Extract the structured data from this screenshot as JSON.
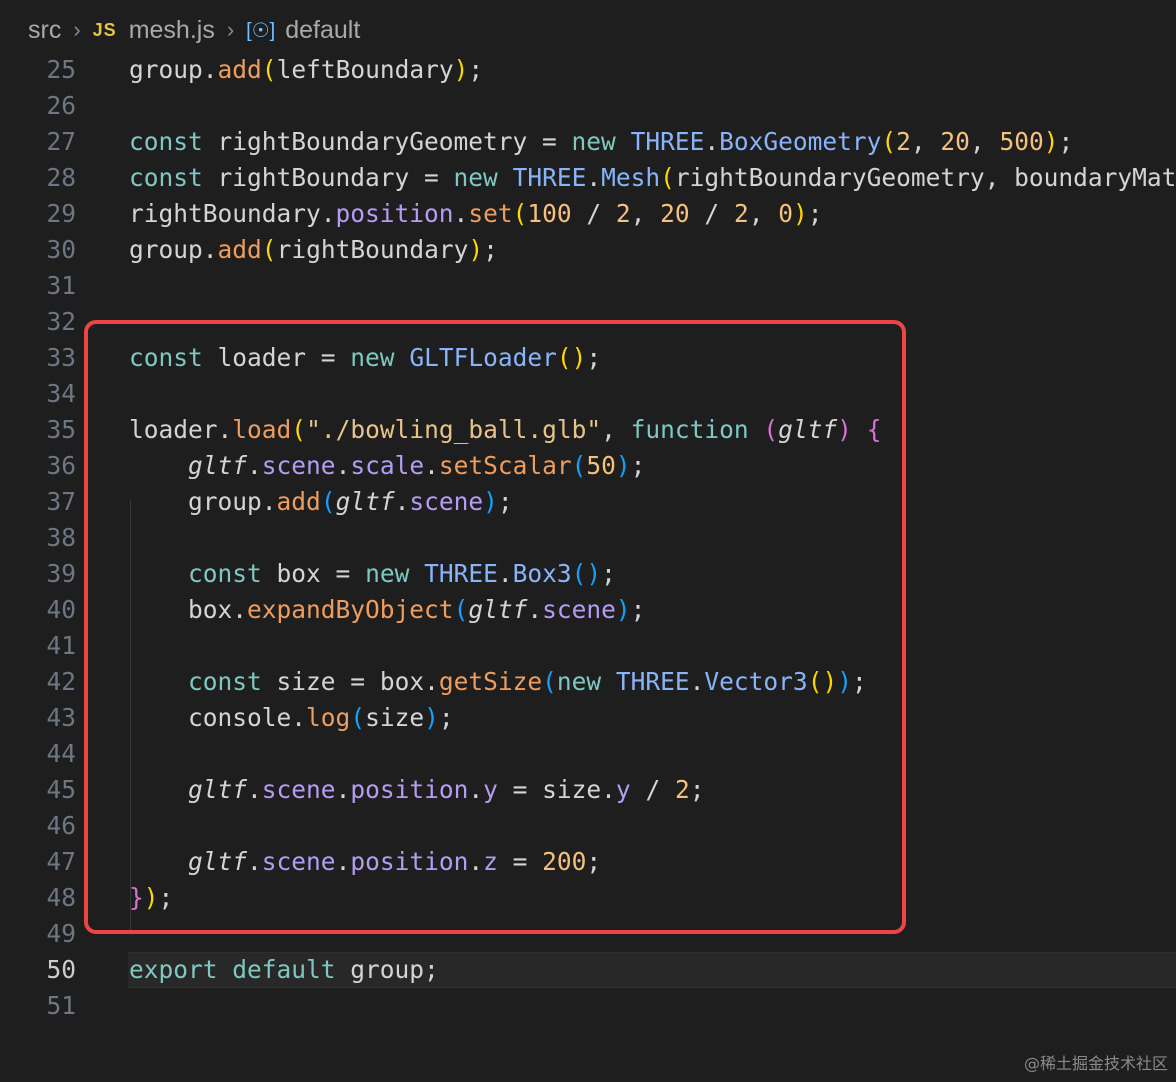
{
  "breadcrumb": {
    "folder": "src",
    "file_icon": "JS",
    "file": "mesh.js",
    "symbol_icon": "variable-icon",
    "symbol": "default"
  },
  "editor": {
    "current_line": 50,
    "highlight_range": [
      32,
      49
    ],
    "lines": [
      {
        "n": "25",
        "tokens": [
          [
            "id",
            "group"
          ],
          [
            "op",
            "."
          ],
          [
            "mth",
            "add"
          ],
          [
            "b1",
            "("
          ],
          [
            "id",
            "leftBoundary"
          ],
          [
            "b1",
            ")"
          ],
          [
            "op",
            ";"
          ]
        ]
      },
      {
        "n": "26",
        "tokens": []
      },
      {
        "n": "27",
        "tokens": [
          [
            "kw",
            "const"
          ],
          [
            "id",
            " rightBoundaryGeometry "
          ],
          [
            "op",
            "="
          ],
          [
            "kw",
            " new "
          ],
          [
            "cls",
            "THREE"
          ],
          [
            "op",
            "."
          ],
          [
            "cls",
            "BoxGeometry"
          ],
          [
            "b1",
            "("
          ],
          [
            "num",
            "2"
          ],
          [
            "op",
            ", "
          ],
          [
            "num",
            "20"
          ],
          [
            "op",
            ", "
          ],
          [
            "num",
            "500"
          ],
          [
            "b1",
            ")"
          ],
          [
            "op",
            ";"
          ]
        ]
      },
      {
        "n": "28",
        "tokens": [
          [
            "kw",
            "const"
          ],
          [
            "id",
            " rightBoundary "
          ],
          [
            "op",
            "="
          ],
          [
            "kw",
            " new "
          ],
          [
            "cls",
            "THREE"
          ],
          [
            "op",
            "."
          ],
          [
            "cls",
            "Mesh"
          ],
          [
            "b1",
            "("
          ],
          [
            "id",
            "rightBoundaryGeometry, boundaryMater"
          ]
        ]
      },
      {
        "n": "29",
        "tokens": [
          [
            "id",
            "rightBoundary"
          ],
          [
            "op",
            "."
          ],
          [
            "prop",
            "position"
          ],
          [
            "op",
            "."
          ],
          [
            "mth",
            "set"
          ],
          [
            "b1",
            "("
          ],
          [
            "num",
            "100"
          ],
          [
            "op",
            " / "
          ],
          [
            "num",
            "2"
          ],
          [
            "op",
            ", "
          ],
          [
            "num",
            "20"
          ],
          [
            "op",
            " / "
          ],
          [
            "num",
            "2"
          ],
          [
            "op",
            ", "
          ],
          [
            "num",
            "0"
          ],
          [
            "b1",
            ")"
          ],
          [
            "op",
            ";"
          ]
        ]
      },
      {
        "n": "30",
        "tokens": [
          [
            "id",
            "group"
          ],
          [
            "op",
            "."
          ],
          [
            "mth",
            "add"
          ],
          [
            "b1",
            "("
          ],
          [
            "id",
            "rightBoundary"
          ],
          [
            "b1",
            ")"
          ],
          [
            "op",
            ";"
          ]
        ]
      },
      {
        "n": "31",
        "tokens": []
      },
      {
        "n": "32",
        "tokens": []
      },
      {
        "n": "33",
        "tokens": [
          [
            "kw",
            "const"
          ],
          [
            "id",
            " loader "
          ],
          [
            "op",
            "="
          ],
          [
            "kw",
            " new "
          ],
          [
            "cls",
            "GLTFLoader"
          ],
          [
            "b1",
            "()"
          ],
          [
            "op",
            ";"
          ]
        ]
      },
      {
        "n": "34",
        "tokens": []
      },
      {
        "n": "35",
        "tokens": [
          [
            "id",
            "loader"
          ],
          [
            "op",
            "."
          ],
          [
            "mth",
            "load"
          ],
          [
            "b1",
            "("
          ],
          [
            "str",
            "\"./bowling_ball.glb\""
          ],
          [
            "op",
            ", "
          ],
          [
            "kw",
            "function"
          ],
          [
            "op",
            " "
          ],
          [
            "b2",
            "("
          ],
          [
            "it",
            "gltf"
          ],
          [
            "b2",
            ")"
          ],
          [
            "op",
            " "
          ],
          [
            "b2",
            "{"
          ]
        ]
      },
      {
        "n": "36",
        "tokens": [
          [
            "op",
            "    "
          ],
          [
            "it",
            "gltf"
          ],
          [
            "op",
            "."
          ],
          [
            "prop",
            "scene"
          ],
          [
            "op",
            "."
          ],
          [
            "prop",
            "scale"
          ],
          [
            "op",
            "."
          ],
          [
            "mth",
            "setScalar"
          ],
          [
            "b3",
            "("
          ],
          [
            "num",
            "50"
          ],
          [
            "b3",
            ")"
          ],
          [
            "op",
            ";"
          ]
        ]
      },
      {
        "n": "37",
        "tokens": [
          [
            "op",
            "    "
          ],
          [
            "id",
            "group"
          ],
          [
            "op",
            "."
          ],
          [
            "mth",
            "add"
          ],
          [
            "b3",
            "("
          ],
          [
            "it",
            "gltf"
          ],
          [
            "op",
            "."
          ],
          [
            "prop",
            "scene"
          ],
          [
            "b3",
            ")"
          ],
          [
            "op",
            ";"
          ]
        ]
      },
      {
        "n": "38",
        "tokens": []
      },
      {
        "n": "39",
        "tokens": [
          [
            "op",
            "    "
          ],
          [
            "kw",
            "const"
          ],
          [
            "id",
            " box "
          ],
          [
            "op",
            "="
          ],
          [
            "kw",
            " new "
          ],
          [
            "cls",
            "THREE"
          ],
          [
            "op",
            "."
          ],
          [
            "cls",
            "Box3"
          ],
          [
            "b3",
            "()"
          ],
          [
            "op",
            ";"
          ]
        ]
      },
      {
        "n": "40",
        "tokens": [
          [
            "op",
            "    "
          ],
          [
            "id",
            "box"
          ],
          [
            "op",
            "."
          ],
          [
            "mth",
            "expandByObject"
          ],
          [
            "b3",
            "("
          ],
          [
            "it",
            "gltf"
          ],
          [
            "op",
            "."
          ],
          [
            "prop",
            "scene"
          ],
          [
            "b3",
            ")"
          ],
          [
            "op",
            ";"
          ]
        ]
      },
      {
        "n": "41",
        "tokens": []
      },
      {
        "n": "42",
        "tokens": [
          [
            "op",
            "    "
          ],
          [
            "kw",
            "const"
          ],
          [
            "id",
            " size "
          ],
          [
            "op",
            "="
          ],
          [
            "id",
            " box"
          ],
          [
            "op",
            "."
          ],
          [
            "mth",
            "getSize"
          ],
          [
            "b3",
            "("
          ],
          [
            "kw",
            "new "
          ],
          [
            "cls",
            "THREE"
          ],
          [
            "op",
            "."
          ],
          [
            "cls",
            "Vector3"
          ],
          [
            "b1",
            "()"
          ],
          [
            "b3",
            ")"
          ],
          [
            "op",
            ";"
          ]
        ]
      },
      {
        "n": "43",
        "tokens": [
          [
            "op",
            "    "
          ],
          [
            "id",
            "console"
          ],
          [
            "op",
            "."
          ],
          [
            "mth",
            "log"
          ],
          [
            "b3",
            "("
          ],
          [
            "id",
            "size"
          ],
          [
            "b3",
            ")"
          ],
          [
            "op",
            ";"
          ]
        ]
      },
      {
        "n": "44",
        "tokens": []
      },
      {
        "n": "45",
        "tokens": [
          [
            "op",
            "    "
          ],
          [
            "it",
            "gltf"
          ],
          [
            "op",
            "."
          ],
          [
            "prop",
            "scene"
          ],
          [
            "op",
            "."
          ],
          [
            "prop",
            "position"
          ],
          [
            "op",
            "."
          ],
          [
            "prop",
            "y"
          ],
          [
            "op",
            " = "
          ],
          [
            "id",
            "size"
          ],
          [
            "op",
            "."
          ],
          [
            "prop",
            "y"
          ],
          [
            "op",
            " / "
          ],
          [
            "num",
            "2"
          ],
          [
            "op",
            ";"
          ]
        ]
      },
      {
        "n": "46",
        "tokens": []
      },
      {
        "n": "47",
        "tokens": [
          [
            "op",
            "    "
          ],
          [
            "it",
            "gltf"
          ],
          [
            "op",
            "."
          ],
          [
            "prop",
            "scene"
          ],
          [
            "op",
            "."
          ],
          [
            "prop",
            "position"
          ],
          [
            "op",
            "."
          ],
          [
            "prop",
            "z"
          ],
          [
            "op",
            " = "
          ],
          [
            "num",
            "200"
          ],
          [
            "op",
            ";"
          ]
        ]
      },
      {
        "n": "48",
        "tokens": [
          [
            "b2",
            "}"
          ],
          [
            "b1",
            ")"
          ],
          [
            "op",
            ";"
          ]
        ]
      },
      {
        "n": "49",
        "tokens": []
      },
      {
        "n": "50",
        "tokens": [
          [
            "kw",
            "export"
          ],
          [
            "kw",
            " default"
          ],
          [
            "id",
            " group"
          ],
          [
            "op",
            ";"
          ]
        ]
      },
      {
        "n": "51",
        "tokens": []
      }
    ]
  },
  "watermark": "@稀土掘金技术社区",
  "colors": {
    "background": "#1e1e1e",
    "highlight_border": "#ef4444",
    "keyword": "#7fc8c1",
    "method": "#ee9d5f",
    "property": "#b39df3",
    "class": "#89b4fa",
    "number": "#f5c07a"
  }
}
